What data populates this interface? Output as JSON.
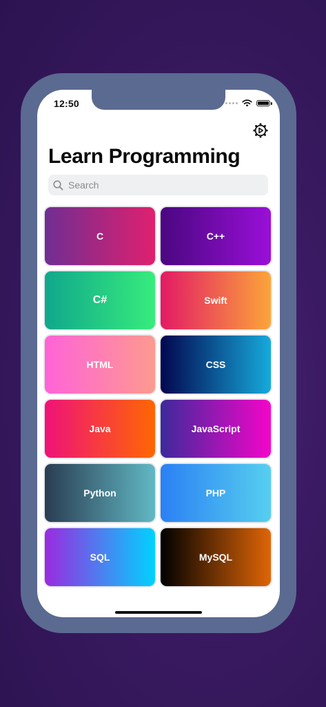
{
  "status_bar": {
    "time": "12:50"
  },
  "header": {
    "title": "Learn Programming",
    "settings_icon": "gear-play-icon"
  },
  "search": {
    "placeholder": "Search",
    "value": "",
    "icon": "search-icon"
  },
  "courses": [
    {
      "label": "C",
      "gradient": [
        "#6f2e92",
        "#e0206f"
      ]
    },
    {
      "label": "C++",
      "gradient": [
        "#4a0780",
        "#9a0fd8"
      ]
    },
    {
      "label": "C#",
      "gradient": [
        "#10a78c",
        "#37ec7c"
      ]
    },
    {
      "label": "Swift",
      "gradient": [
        "#e31a65",
        "#fba53a"
      ]
    },
    {
      "label": "HTML",
      "gradient": [
        "#ff63d8",
        "#fd9a8f"
      ]
    },
    {
      "label": "CSS",
      "gradient": [
        "#02064f",
        "#16aadb"
      ]
    },
    {
      "label": "Java",
      "gradient": [
        "#ef1278",
        "#ff6702"
      ]
    },
    {
      "label": "JavaScript",
      "gradient": [
        "#3c2a9b",
        "#f405c9"
      ]
    },
    {
      "label": "Python",
      "gradient": [
        "#2a3d52",
        "#61b8c4"
      ]
    },
    {
      "label": "PHP",
      "gradient": [
        "#2b80f4",
        "#56cfef"
      ]
    },
    {
      "label": "SQL",
      "gradient": [
        "#9a2ae0",
        "#01d2ff"
      ]
    },
    {
      "label": "MySQL",
      "gradient": [
        "#000000",
        "#e06506"
      ]
    }
  ],
  "colors": {
    "background": "#3a1a62",
    "phone_frame": "#5b6a90",
    "search_bg": "#eef0f1"
  }
}
